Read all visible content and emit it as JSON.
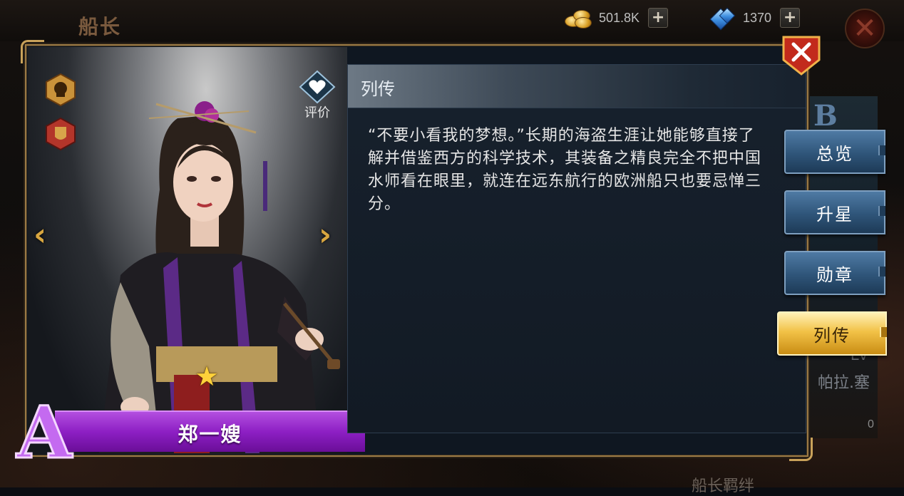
{
  "header": {
    "title": "船长",
    "gold": {
      "icon": "gold-coins-icon",
      "value": "501.8K"
    },
    "gems": {
      "icon": "diamond-icon",
      "value": "1370"
    },
    "plus_symbol": "+"
  },
  "background": {
    "side_card": {
      "tier_letter": "B",
      "level_label": "LV",
      "name": "帕拉.塞",
      "count": "0"
    },
    "bottom_text": "船长羁绊"
  },
  "character": {
    "name": "郑一嫂",
    "rank": "A",
    "stars": 1,
    "rate_label": "评价",
    "prev_arrow": "‹",
    "next_arrow": "›",
    "star_symbol": "★"
  },
  "panel": {
    "title": "列传",
    "body": "“不要小看我的梦想。”长期的海盗生涯让她能够直接了解并借鉴西方的科学技术，其装备之精良完全不把中国水师看在眼里，就连在远东航行的欧洲船只也要忌惮三分。"
  },
  "tabs": [
    {
      "label": "总览",
      "active": false
    },
    {
      "label": "升星",
      "active": false
    },
    {
      "label": "勋章",
      "active": false
    },
    {
      "label": "列传",
      "active": true
    }
  ],
  "colors": {
    "accent_gold": "#c9a25a",
    "name_banner": "#8d1fc4",
    "tab_blue": "#2f5579",
    "tab_active": "#f2c247",
    "close_red": "#c22a1c"
  }
}
